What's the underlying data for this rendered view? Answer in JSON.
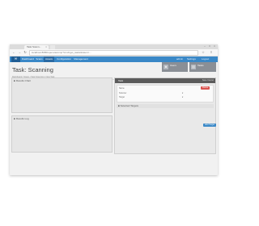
{
  "browser": {
    "tab_title": "Task Scann...",
    "tab_close": "×",
    "new_tab": "",
    "window_controls": {
      "minimize": "–",
      "maximize": "□",
      "close": "×"
    },
    "url": "localhost:8080/openvas/omp?cmd=get_tasks&token=...",
    "nav_icons": {
      "back": "←",
      "forward": "→",
      "reload": "↻"
    },
    "right_icons": {
      "star": "☆",
      "menu": "≡"
    }
  },
  "app": {
    "logo": "∞",
    "nav": [
      {
        "label": "Dashboard"
      },
      {
        "label": "Scans"
      },
      {
        "label": "Assets"
      },
      {
        "label": "Configuration"
      },
      {
        "label": "Management"
      }
    ],
    "nav_right": {
      "user": "admin",
      "settings": "Settings",
      "logout": "Logout"
    }
  },
  "stats": [
    {
      "icon": "users-icon",
      "label": "Users",
      "sub": ""
    },
    {
      "icon": "tasks-icon",
      "label": "Tasks",
      "sub": ""
    }
  ],
  "page": {
    "title": "Task: Scanning",
    "breadcrumb": "Dashboard  /  Scans  /  Task Scanning  /  New Task"
  },
  "panels": {
    "left_top": {
      "label": "Results Chart"
    },
    "left_bottom": {
      "label": "Results Log"
    }
  },
  "task": {
    "header": "Task",
    "actions": "Save   Cancel",
    "delete_label": "Delete",
    "rows": [
      {
        "label": "Name",
        "value": ""
      },
      {
        "label": "Scanner",
        "value": "▾"
      },
      {
        "label": "Target",
        "value": "▾"
      }
    ],
    "sub_header": "Selected Targets",
    "add_button": "Add Target"
  }
}
